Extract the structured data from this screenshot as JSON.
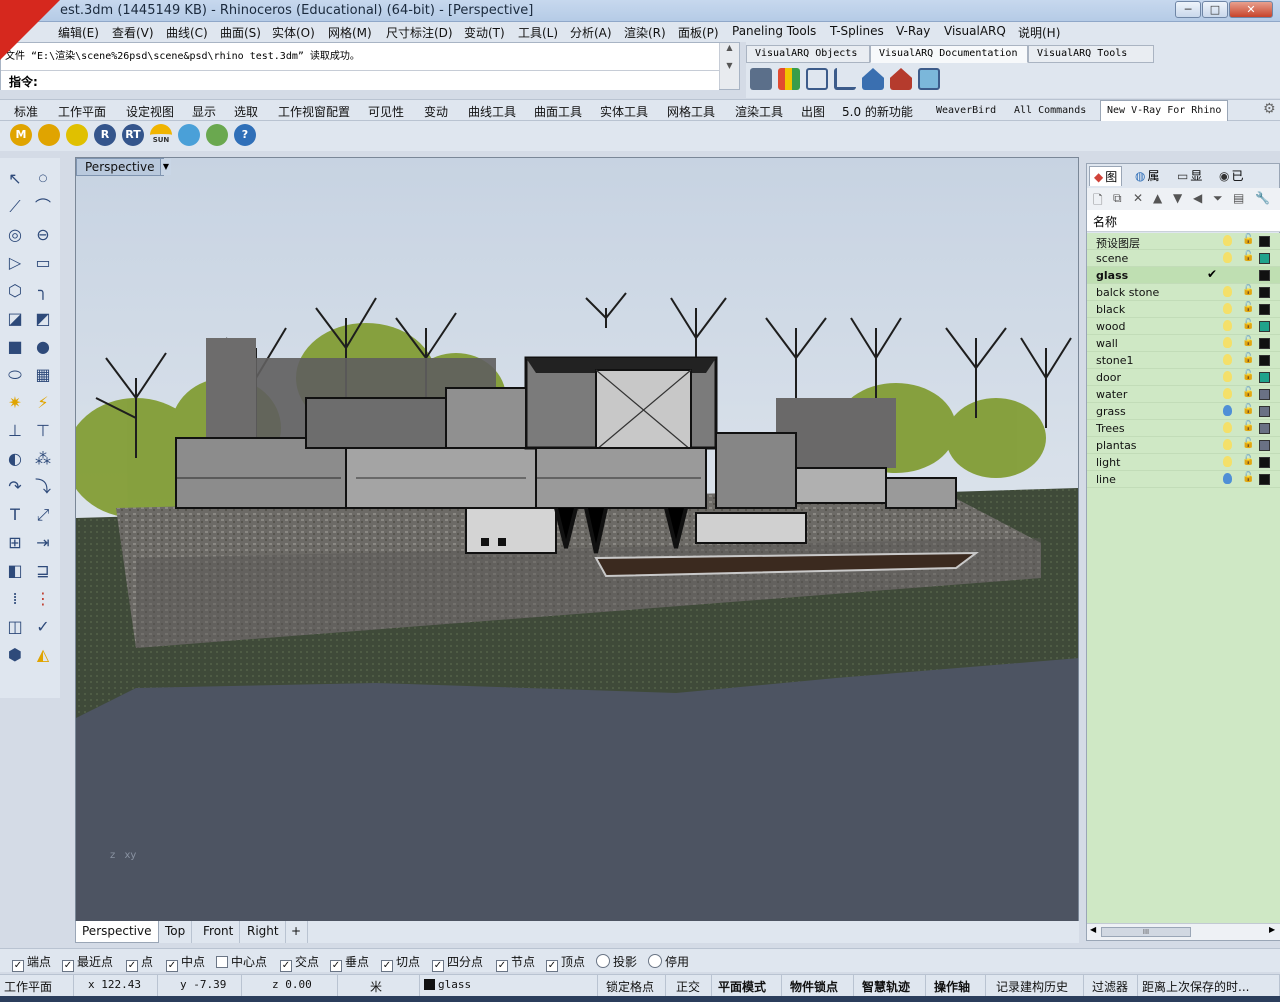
{
  "window": {
    "title": "est.3dm (1445149 KB) - Rhinoceros (Educational) (64-bit) - [Perspective]",
    "min_label": "─",
    "max_label": "□",
    "close_label": "✕"
  },
  "logo": {
    "text": "xuexiniu 学犀牛中文网"
  },
  "menu": [
    "编辑(E)",
    "查看(V)",
    "曲线(C)",
    "曲面(S)",
    "实体(O)",
    "网格(M)",
    "尺寸标注(D)",
    "变动(T)",
    "工具(L)",
    "分析(A)",
    "渲染(R)",
    "面板(P)",
    "Paneling Tools",
    "T-Splines",
    "V-Ray",
    "VisualARQ",
    "说明(H)"
  ],
  "command": {
    "history": "文件 “E:\\渲染\\scene%26psd\\scene&psd\\rhino test.3dm” 读取成功。",
    "prompt": "指令:",
    "input_value": ""
  },
  "visualarq": {
    "tabs": [
      "VisualARQ Objects",
      "VisualARQ Documentation",
      "VisualARQ Tools"
    ],
    "active_tab": 1
  },
  "toolbar_tabs": [
    "标准",
    "工作平面",
    "设定视图",
    "显示",
    "选取",
    "工作视窗配置",
    "可见性",
    "变动",
    "曲线工具",
    "曲面工具",
    "实体工具",
    "网格工具",
    "渲染工具",
    "出图",
    "5.0 的新功能",
    "WeaverBird",
    "All Commands",
    "New V-Ray For Rhino"
  ],
  "std_icons": [
    {
      "icon": "m-icon",
      "text": "M",
      "color": "#e0a400"
    },
    {
      "icon": "material-icon",
      "text": "",
      "color": "#e0a400"
    },
    {
      "icon": "tag-icon",
      "text": "",
      "color": "#e0c000"
    },
    {
      "icon": "r-render-icon",
      "text": "R",
      "color": "#34558c"
    },
    {
      "icon": "rt-render-icon",
      "text": "RT",
      "color": "#34558c"
    },
    {
      "icon": "sun-icon",
      "text": "SUN",
      "color": "#f0b400"
    },
    {
      "icon": "light-icon",
      "text": "",
      "color": "#4aa0d8"
    },
    {
      "icon": "environment-icon",
      "text": "",
      "color": "#6aa84f"
    },
    {
      "icon": "help-icon",
      "text": "?",
      "color": "#2f6fb8"
    }
  ],
  "viewport": {
    "label": "Perspective",
    "axis_z": "z",
    "axis_xy": "xy"
  },
  "view_tabs": [
    "Perspective",
    "Top",
    "Front",
    "Right",
    "+"
  ],
  "layers_panel": {
    "tabs": [
      "图",
      "属",
      "显",
      "已"
    ],
    "header": "名称",
    "layers": [
      {
        "name": "预设图层",
        "bulb": "#f4e06a",
        "color": "#111111",
        "current": false
      },
      {
        "name": "scene",
        "bulb": "#f4e06a",
        "color": "#1fa38c",
        "current": false
      },
      {
        "name": "glass",
        "bulb": "",
        "color": "#111111",
        "current": true
      },
      {
        "name": "balck stone",
        "bulb": "#f4e06a",
        "color": "#111111",
        "current": false
      },
      {
        "name": "black",
        "bulb": "#f4e06a",
        "color": "#111111",
        "current": false
      },
      {
        "name": "wood",
        "bulb": "#f4e06a",
        "color": "#1fa38c",
        "current": false
      },
      {
        "name": "wall",
        "bulb": "#f4e06a",
        "color": "#111111",
        "current": false
      },
      {
        "name": "stone1",
        "bulb": "#f4e06a",
        "color": "#111111",
        "current": false
      },
      {
        "name": "door",
        "bulb": "#f4e06a",
        "color": "#1fa38c",
        "current": false
      },
      {
        "name": "water",
        "bulb": "#f4e06a",
        "color": "#6a7184",
        "current": false
      },
      {
        "name": "grass",
        "bulb": "#4f8fd6",
        "color": "#6a7184",
        "current": false
      },
      {
        "name": "Trees",
        "bulb": "#f4e06a",
        "color": "#6a7184",
        "current": false
      },
      {
        "name": "plantas",
        "bulb": "#f4e06a",
        "color": "#6a7184",
        "current": false
      },
      {
        "name": "light",
        "bulb": "#f4e06a",
        "color": "#111111",
        "current": false
      },
      {
        "name": "line",
        "bulb": "#4f8fd6",
        "color": "#111111",
        "current": false
      }
    ],
    "current_mark": "✔",
    "scroll_thumb": "III"
  },
  "osnaps": [
    {
      "label": "端点",
      "checked": true
    },
    {
      "label": "最近点",
      "checked": true
    },
    {
      "label": "点",
      "checked": true
    },
    {
      "label": "中点",
      "checked": true
    },
    {
      "label": "中心点",
      "checked": false
    },
    {
      "label": "交点",
      "checked": true
    },
    {
      "label": "垂点",
      "checked": true
    },
    {
      "label": "切点",
      "checked": true
    },
    {
      "label": "四分点",
      "checked": true
    },
    {
      "label": "节点",
      "checked": true
    },
    {
      "label": "顶点",
      "checked": true
    },
    {
      "label": "投影",
      "checked": false,
      "radio": true
    },
    {
      "label": "停用",
      "checked": false,
      "radio": true
    }
  ],
  "status": {
    "cplane": "工作平面",
    "x": "x 122.43",
    "y": "y -7.39",
    "z": "z 0.00",
    "unit": "米",
    "layer": "glass",
    "snap": "锁定格点",
    "ortho": "正交",
    "planar": "平面模式",
    "osnap": "物件锁点",
    "smarttrack": "智慧轨迹",
    "gumball": "操作轴",
    "history": "记录建构历史",
    "filter": "过滤器",
    "autosave": "距离上次保存的时..."
  }
}
